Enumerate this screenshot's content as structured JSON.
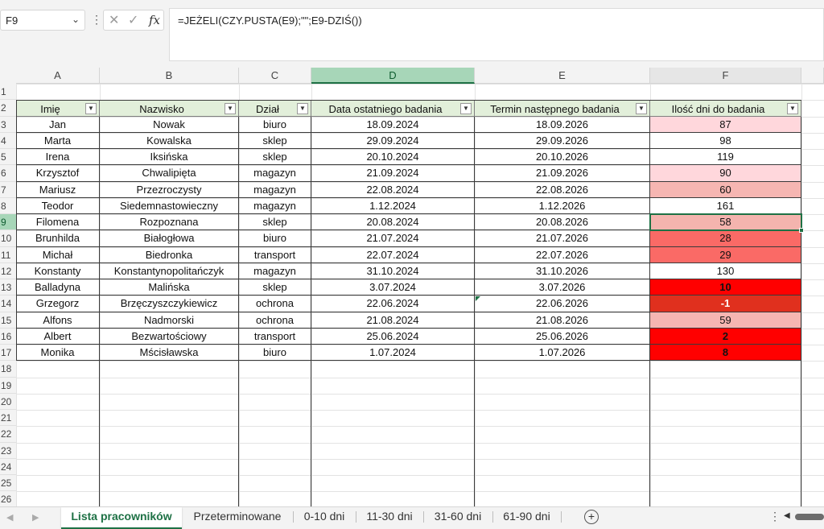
{
  "formula_bar": {
    "cell_ref": "F9",
    "formula": "=JEŻELI(CZY.PUSTA(E9);\"\";E9-DZIŚ())",
    "icons": [
      "chevron-down-icon",
      "more-vertical-icon",
      "cancel-x-icon",
      "confirm-check-icon",
      "function-fx-icon"
    ]
  },
  "grid": {
    "column_letters": [
      "A",
      "B",
      "C",
      "D",
      "E",
      "F"
    ],
    "selected_column": "D",
    "row_numbers": [
      "1",
      "2",
      "3",
      "4",
      "5",
      "6",
      "7",
      "8",
      "9",
      "10",
      "11",
      "12",
      "13",
      "14",
      "15",
      "16",
      "17",
      "18",
      "19",
      "20",
      "21",
      "22",
      "23",
      "24",
      "25",
      "26"
    ],
    "selected_row": "9",
    "headers": [
      "Imię",
      "Nazwisko",
      "Dział",
      "Data ostatniego badania",
      "Termin następnego badania",
      "Ilość dni  do badania"
    ],
    "rows": [
      {
        "imie": "Jan",
        "nazwisko": "Nowak",
        "dzial": "biuro",
        "ostatnie": "18.09.2024",
        "nastepne": "18.09.2026",
        "dni": "87",
        "fill": "#ffd7dc",
        "bold": false,
        "text_color": "#111111"
      },
      {
        "imie": "Marta",
        "nazwisko": "Kowalska",
        "dzial": "sklep",
        "ostatnie": "29.09.2024",
        "nastepne": "29.09.2026",
        "dni": "98",
        "fill": "#ffffff",
        "bold": false,
        "text_color": "#111111"
      },
      {
        "imie": "Irena",
        "nazwisko": "Iksińska",
        "dzial": "sklep",
        "ostatnie": "20.10.2024",
        "nastepne": "20.10.2026",
        "dni": "119",
        "fill": "#ffffff",
        "bold": false,
        "text_color": "#111111"
      },
      {
        "imie": "Krzysztof",
        "nazwisko": "Chwalipięta",
        "dzial": "magazyn",
        "ostatnie": "21.09.2024",
        "nastepne": "21.09.2026",
        "dni": "90",
        "fill": "#ffd7dc",
        "bold": false,
        "text_color": "#111111"
      },
      {
        "imie": "Mariusz",
        "nazwisko": "Przezroczysty",
        "dzial": "magazyn",
        "ostatnie": "22.08.2024",
        "nastepne": "22.08.2026",
        "dni": "60",
        "fill": "#f6b6b2",
        "bold": false,
        "text_color": "#111111"
      },
      {
        "imie": "Teodor",
        "nazwisko": "Siedemnastowieczny",
        "dzial": "magazyn",
        "ostatnie": "1.12.2024",
        "nastepne": "1.12.2026",
        "dni": "161",
        "fill": "#ffffff",
        "bold": false,
        "text_color": "#111111"
      },
      {
        "imie": "Filomena",
        "nazwisko": "Rozpoznana",
        "dzial": "sklep",
        "ostatnie": "20.08.2024",
        "nastepne": "20.08.2026",
        "dni": "58",
        "fill": "#f4b4ae",
        "bold": false,
        "text_color": "#111111"
      },
      {
        "imie": "Brunhilda",
        "nazwisko": "Białogłowa",
        "dzial": "biuro",
        "ostatnie": "21.07.2024",
        "nastepne": "21.07.2026",
        "dni": "28",
        "fill": "#fa6a66",
        "bold": false,
        "text_color": "#111111"
      },
      {
        "imie": "Michał",
        "nazwisko": "Biedronka",
        "dzial": "transport",
        "ostatnie": "22.07.2024",
        "nastepne": "22.07.2026",
        "dni": "29",
        "fill": "#fa6a66",
        "bold": false,
        "text_color": "#111111"
      },
      {
        "imie": "Konstanty",
        "nazwisko": "Konstantynopolitańczyk",
        "dzial": "magazyn",
        "ostatnie": "31.10.2024",
        "nastepne": "31.10.2026",
        "dni": "130",
        "fill": "#ffffff",
        "bold": false,
        "text_color": "#111111"
      },
      {
        "imie": "Balladyna",
        "nazwisko": "Malińska",
        "dzial": "sklep",
        "ostatnie": "3.07.2024",
        "nastepne": "3.07.2026",
        "dni": "10",
        "fill": "#ff0000",
        "bold": true,
        "text_color": "#111111"
      },
      {
        "imie": "Grzegorz",
        "nazwisko": "Brzęczyszczykiewicz",
        "dzial": "ochrona",
        "ostatnie": "22.06.2024",
        "nastepne": "22.06.2026",
        "dni": "-1",
        "fill": "#e0301e",
        "bold": true,
        "text_color": "#ffffff"
      },
      {
        "imie": "Alfons",
        "nazwisko": "Nadmorski",
        "dzial": "ochrona",
        "ostatnie": "21.08.2024",
        "nastepne": "21.08.2026",
        "dni": "59",
        "fill": "#f6b6b2",
        "bold": false,
        "text_color": "#111111"
      },
      {
        "imie": "Albert",
        "nazwisko": "Bezwartościowy",
        "dzial": "transport",
        "ostatnie": "25.06.2024",
        "nastepne": "25.06.2026",
        "dni": "2",
        "fill": "#ff0000",
        "bold": true,
        "text_color": "#111111"
      },
      {
        "imie": "Monika",
        "nazwisko": "Mścisławska",
        "dzial": "biuro",
        "ostatnie": "1.07.2024",
        "nastepne": "1.07.2026",
        "dni": "8",
        "fill": "#ff0000",
        "bold": true,
        "text_color": "#111111"
      }
    ]
  },
  "sheet_tabs": {
    "tabs": [
      "Lista pracowników",
      "Przeterminowane",
      "0-10 dni",
      "11-30 dni",
      "31-60 dni",
      "61-90 dni"
    ],
    "active": "Lista pracowników",
    "add_symbol": "+",
    "more_symbol": "⋮"
  },
  "colors": {
    "header_fill": "#e2efda",
    "accent": "#1e7145",
    "selected_header": "#a7d6b8"
  }
}
